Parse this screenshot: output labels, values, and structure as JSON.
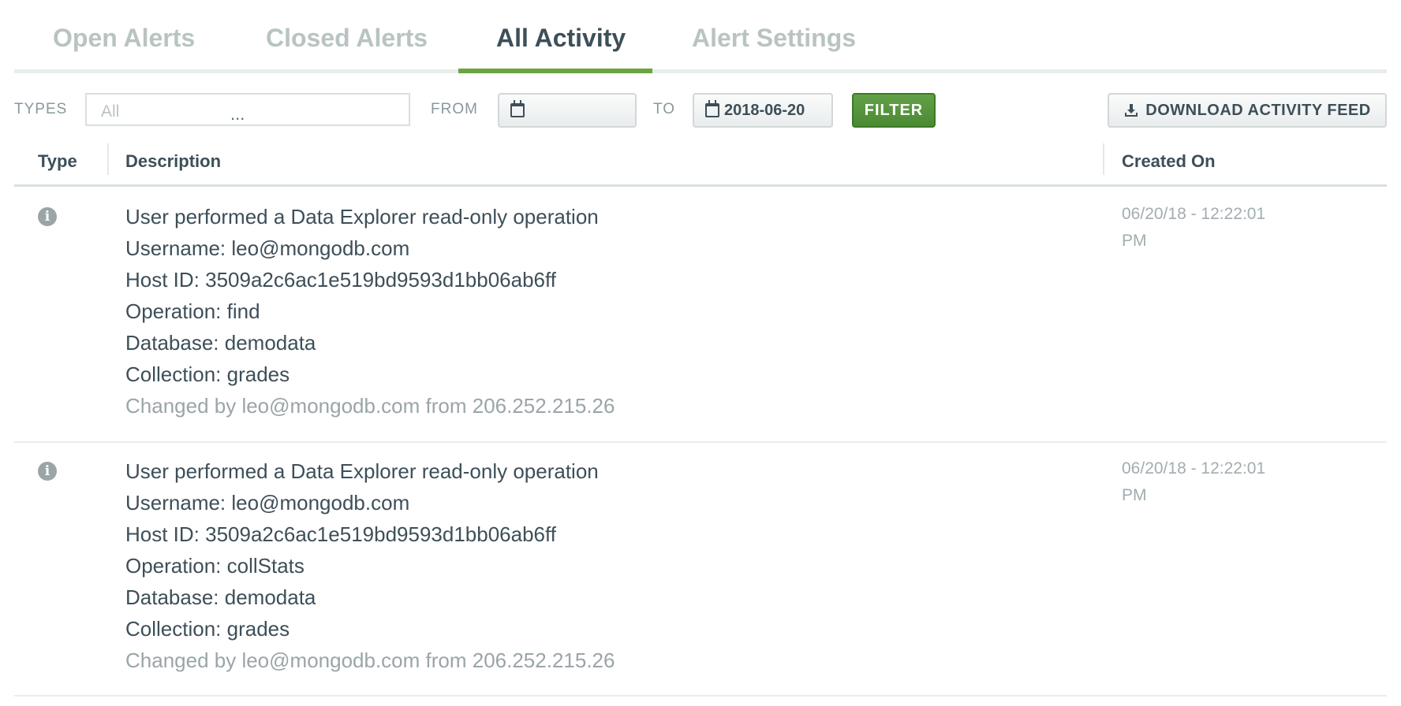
{
  "tabs": [
    {
      "label": "Open Alerts",
      "active": false
    },
    {
      "label": "Closed Alerts",
      "active": false
    },
    {
      "label": "All Activity",
      "active": true
    },
    {
      "label": "Alert Settings",
      "active": false
    }
  ],
  "filters": {
    "types_label": "TYPES",
    "types_placeholder": "All",
    "types_dots": "...",
    "from_label": "FROM",
    "from_value": "",
    "to_label": "TO",
    "to_value": "2018-06-20",
    "filter_button": "FILTER",
    "download_button": "DOWNLOAD ACTIVITY FEED"
  },
  "table": {
    "columns": [
      "Type",
      "Description",
      "Created On"
    ],
    "rows": [
      {
        "type_icon": "info-icon",
        "lines": [
          "User performed a Data Explorer read-only operation",
          "Username: leo@mongodb.com",
          "Host ID: 3509a2c6ac1e519bd9593d1bb06ab6ff",
          "Operation: find",
          "Database: demodata",
          "Collection: grades"
        ],
        "changed_by": "Changed by leo@mongodb.com from 206.252.215.26",
        "created_date": "06/20/18 - 12:22:01",
        "created_ampm": "PM"
      },
      {
        "type_icon": "info-icon",
        "lines": [
          "User performed a Data Explorer read-only operation",
          "Username: leo@mongodb.com",
          "Host ID: 3509a2c6ac1e519bd9593d1bb06ab6ff",
          "Operation: collStats",
          "Database: demodata",
          "Collection: grades"
        ],
        "changed_by": "Changed by leo@mongodb.com from 206.252.215.26",
        "created_date": "06/20/18 - 12:22:01",
        "created_ampm": "PM"
      }
    ]
  },
  "colors": {
    "accent": "#6ba442",
    "filter_button": "#589642",
    "text": "#3d4f58",
    "muted": "#9aa5a8"
  }
}
